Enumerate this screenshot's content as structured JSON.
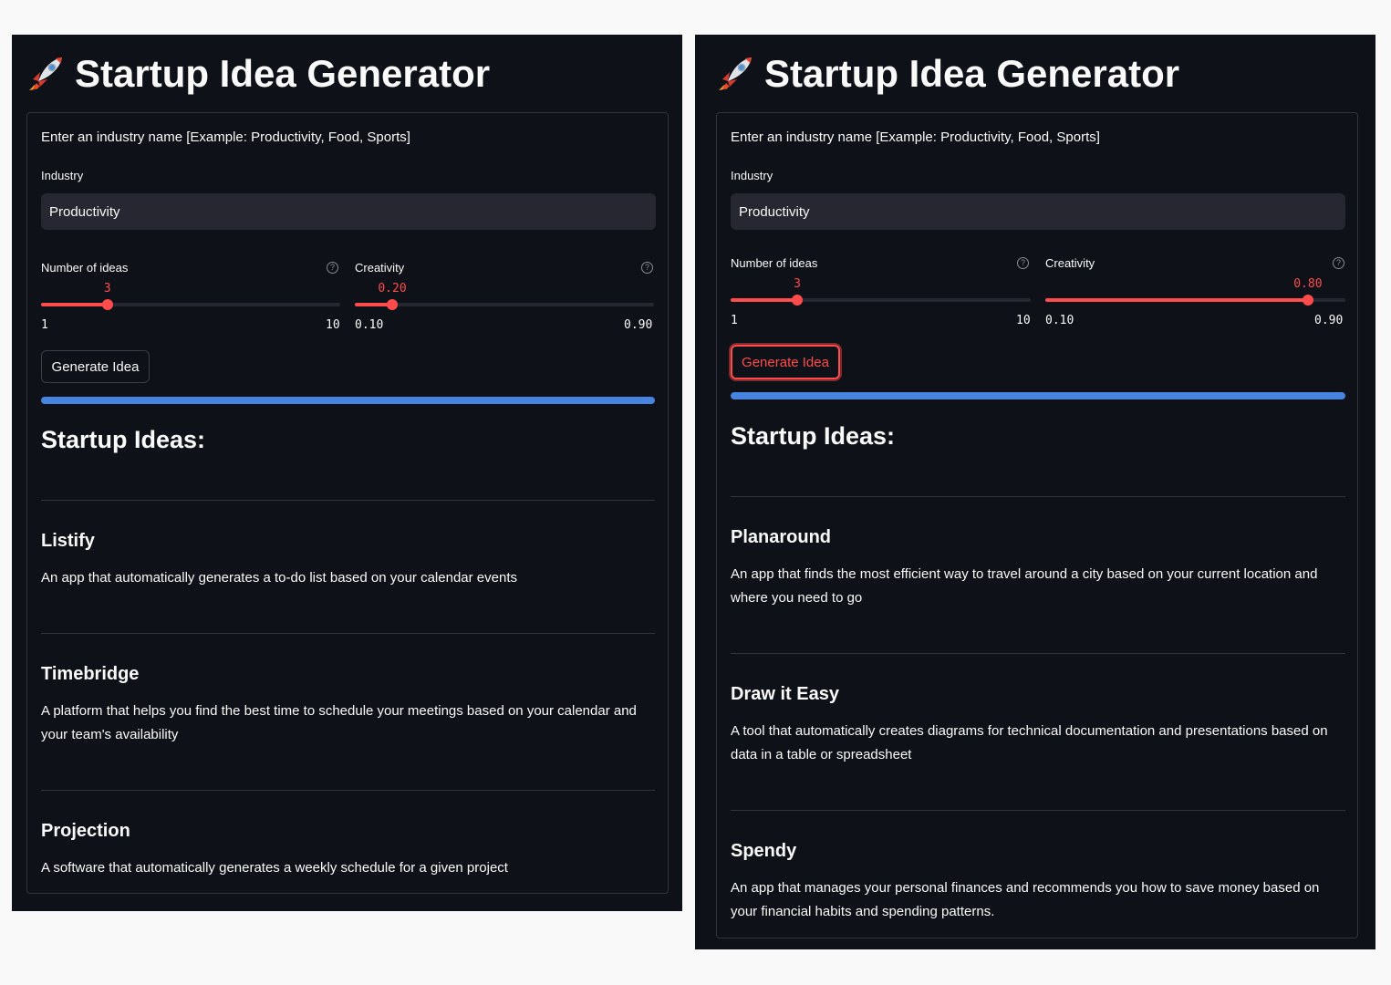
{
  "panels": [
    {
      "title": "Startup Idea Generator",
      "prompt": "Enter an industry name [Example: Productivity, Food, Sports]",
      "industry_label": "Industry",
      "industry_value": "Productivity",
      "num_ideas": {
        "label": "Number of ideas",
        "value": "3",
        "min": "1",
        "max": "10",
        "fraction": 0.222
      },
      "creativity": {
        "label": "Creativity",
        "value": "0.20",
        "min": "0.10",
        "max": "0.90",
        "fraction": 0.125
      },
      "button_label": "Generate Idea",
      "progress": 1.0,
      "results_heading": "Startup Ideas:",
      "ideas": [
        {
          "name": "Listify",
          "description": "An app that automatically generates a to-do list based on your calendar events"
        },
        {
          "name": "Timebridge",
          "description": "A platform that helps you find the best time to schedule your meetings based on your calendar and your team's availability"
        },
        {
          "name": "Projection",
          "description": "A software that automatically generates a weekly schedule for a given project"
        }
      ]
    },
    {
      "title": "Startup Idea Generator",
      "prompt": "Enter an industry name [Example: Productivity, Food, Sports]",
      "industry_label": "Industry",
      "industry_value": "Productivity",
      "num_ideas": {
        "label": "Number of ideas",
        "value": "3",
        "min": "1",
        "max": "10",
        "fraction": 0.222
      },
      "creativity": {
        "label": "Creativity",
        "value": "0.80",
        "min": "0.10",
        "max": "0.90",
        "fraction": 0.875
      },
      "button_label": "Generate Idea",
      "progress": 1.0,
      "results_heading": "Startup Ideas:",
      "ideas": [
        {
          "name": "Planaround",
          "description": "An app that finds the most efficient way to travel around a city based on your current location and where you need to go"
        },
        {
          "name": "Draw it Easy",
          "description": "A tool that automatically creates diagrams for technical documentation and presentations based on data in a table or spreadsheet"
        },
        {
          "name": "Spendy",
          "description": "An app that manages your personal finances and recommends you how to save money based on your financial habits and spending patterns."
        }
      ]
    }
  ],
  "colors": {
    "background": "#0e1117",
    "accent": "#ff4b4b",
    "progress": "#4784e0",
    "input_bg": "#262730"
  }
}
